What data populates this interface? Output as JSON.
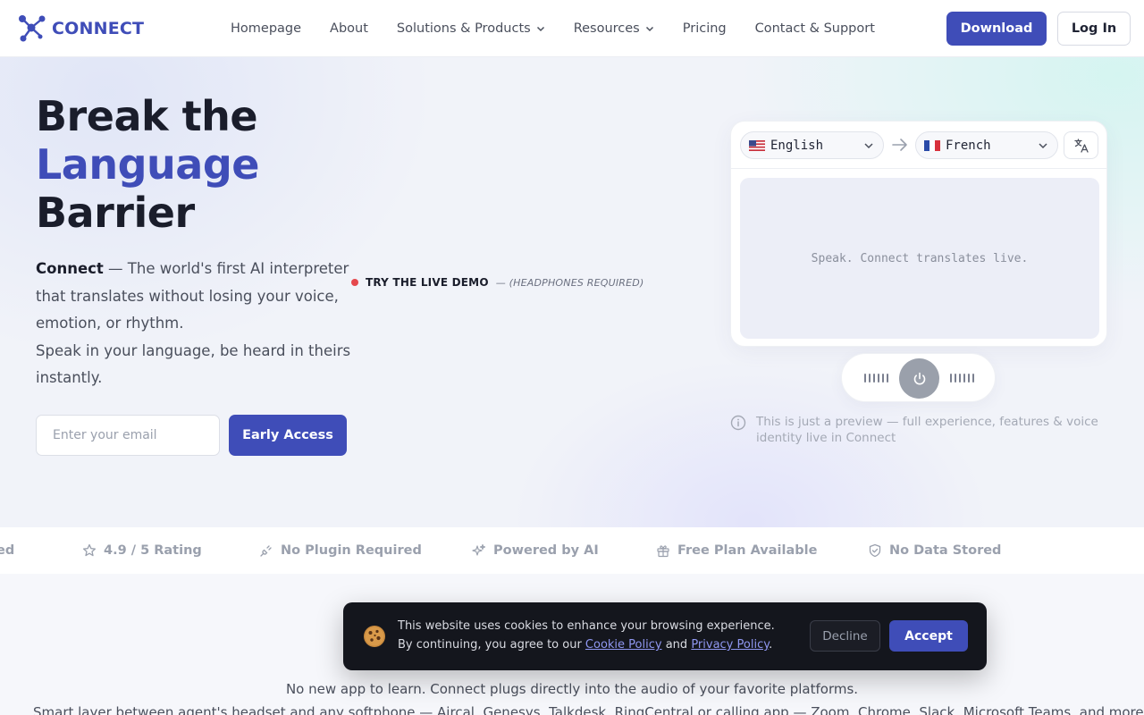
{
  "brand": {
    "name": "CONNECT",
    "logo_icon": "network-nodes-icon"
  },
  "nav": {
    "links": [
      {
        "label": "Homepage",
        "dropdown": false
      },
      {
        "label": "About",
        "dropdown": false
      },
      {
        "label": "Solutions & Products",
        "dropdown": true
      },
      {
        "label": "Resources",
        "dropdown": true
      },
      {
        "label": "Pricing",
        "dropdown": false
      },
      {
        "label": "Contact & Support",
        "dropdown": false
      }
    ],
    "download_label": "Download",
    "login_label": "Log In"
  },
  "hero": {
    "title_line1": "Break the",
    "title_line2": "Language",
    "title_line3": "Barrier",
    "desc_brand": "Connect",
    "desc_text": " — The world's first AI interpreter that translates without losing your voice, emotion, or rhythm.",
    "desc_line2": "Speak in your language, be heard in theirs instantly.",
    "email_placeholder": "Enter your email",
    "cta_label": "Early Access"
  },
  "live_demo": {
    "label": "TRY THE LIVE DEMO",
    "note": "— (HEADPHONES REQUIRED)"
  },
  "translator": {
    "from_language": "English",
    "to_language": "French",
    "placeholder": "Speak. Connect translates live.",
    "preview_note": "This is just a preview — full experience, features & voice identity live in Connect"
  },
  "trust_bar": {
    "items": [
      {
        "label": "ed",
        "icon": ""
      },
      {
        "label": "4.9 / 5 Rating",
        "icon": "star-icon"
      },
      {
        "label": "No Plugin Required",
        "icon": "plug-icon"
      },
      {
        "label": "Powered by AI",
        "icon": "sparkles-icon"
      },
      {
        "label": "Free Plan Available",
        "icon": "gift-icon"
      },
      {
        "label": "No Data Stored",
        "icon": "shield-check-icon"
      }
    ]
  },
  "lower": {
    "line1": "No new app to learn. Connect plugs directly into the audio of your favorite platforms.",
    "line2": "Smart layer between agent's headset and any softphone — Aircal, Genesys, Talkdesk, RingCentral or calling app — Zoom, Chrome, Slack, Microsoft Teams, and more"
  },
  "cookie": {
    "text_before": "This website uses cookies to enhance your browsing experience. By continuing, you agree to our ",
    "cookie_policy": "Cookie Policy",
    "and": " and ",
    "privacy_policy": "Privacy Policy",
    "text_end": ".",
    "decline_label": "Decline",
    "accept_label": "Accept"
  },
  "colors": {
    "brand": "#3f4db8",
    "live_dot": "#e5484d",
    "cookie_bg": "#14161d"
  }
}
